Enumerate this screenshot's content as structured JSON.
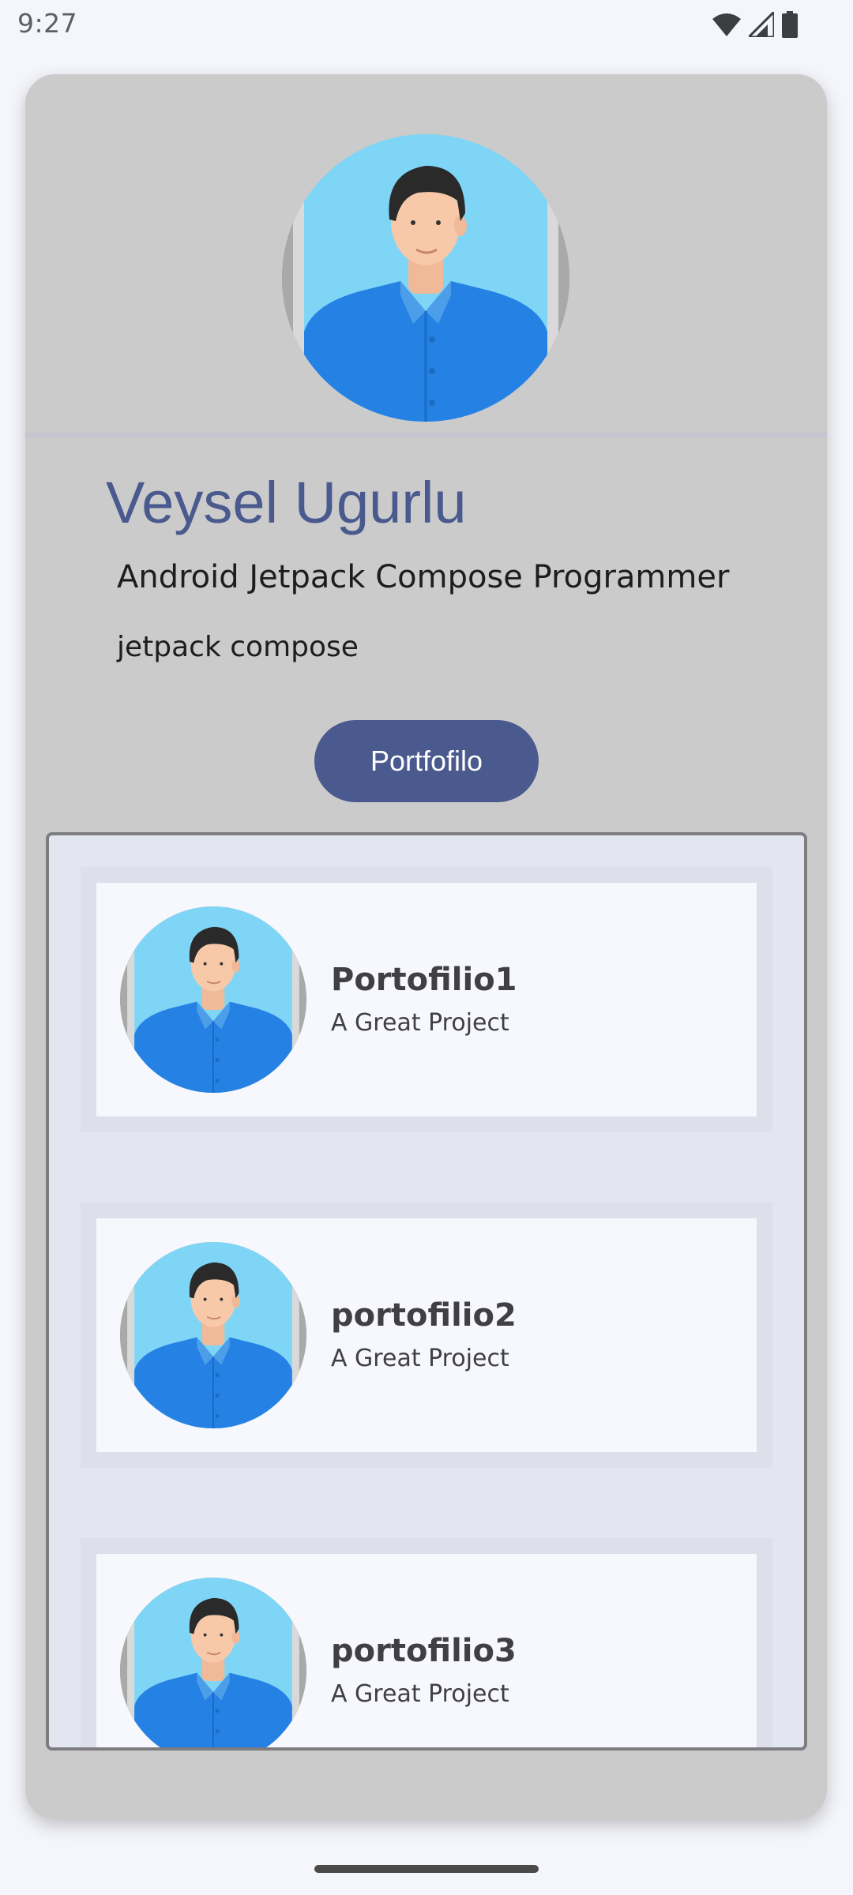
{
  "status_bar": {
    "time": "9:27",
    "icons": [
      "wifi-icon",
      "cellular-signal-icon",
      "battery-icon"
    ]
  },
  "profile": {
    "avatar": "person-avatar",
    "name": "Veysel Ugurlu",
    "title": "Android Jetpack Compose Programmer",
    "skill": "jetpack compose",
    "portfolio_button": "Portfofilo"
  },
  "portfolio": {
    "items": [
      {
        "title": "Portofilio1",
        "subtitle": "A Great Project",
        "avatar": "person-avatar"
      },
      {
        "title": "portofilio2",
        "subtitle": "A Great Project",
        "avatar": "person-avatar"
      },
      {
        "title": "portofilio3",
        "subtitle": "A Great Project",
        "avatar": "person-avatar"
      }
    ]
  },
  "colors": {
    "accent": "#4a5a8e",
    "card_background": "#cbcbcb",
    "list_background": "#e3e5f0",
    "item_background": "#f7f8fd"
  }
}
